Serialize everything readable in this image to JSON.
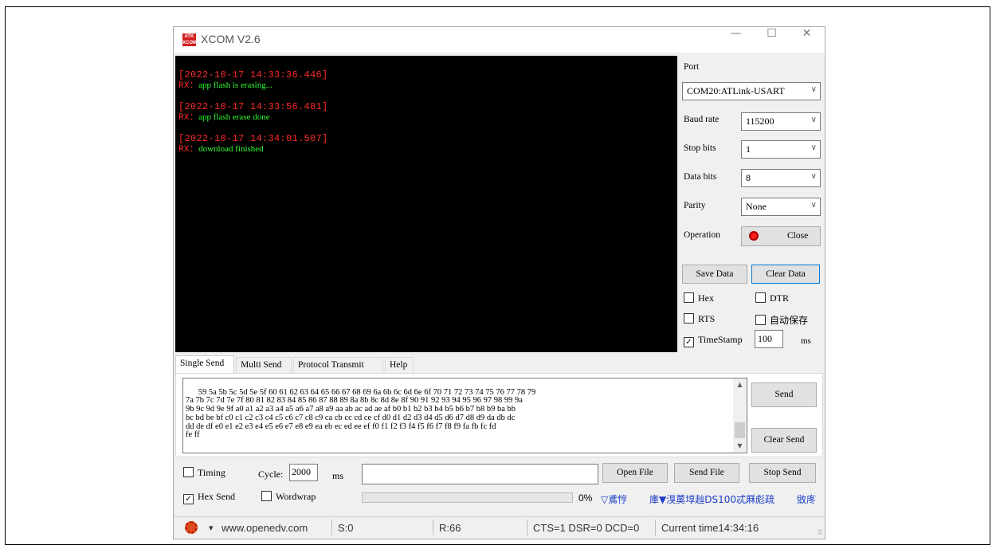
{
  "window": {
    "title": "XCOM V2.6",
    "logo_text": "ATK XCOM",
    "minimize_glyph": "—",
    "maximize_glyph": "☐",
    "close_glyph": "✕"
  },
  "terminal": {
    "entries": [
      {
        "time": "[2022-10-17 14:33:36.446]",
        "rx_prefix": "RX：",
        "rx_text": "app flash is erasing..."
      },
      {
        "time": "[2022-10-17 14:33:56.481]",
        "rx_prefix": "RX：",
        "rx_text": "app flash erase done"
      },
      {
        "time": "[2022-10-17 14:34:01.507]",
        "rx_prefix": "RX：",
        "rx_text": "download finished"
      }
    ]
  },
  "settings": {
    "port_label": "Port",
    "port_value": "COM20:ATLink-USART",
    "baud_label": "Baud rate",
    "baud_value": "115200",
    "stopbits_label": "Stop bits",
    "stopbits_value": "1",
    "databits_label": "Data bits",
    "databits_value": "8",
    "parity_label": "Parity",
    "parity_value": "None",
    "operation_label": "Operation",
    "operation_button": "Close",
    "save_data": "Save Data",
    "clear_data": "Clear Data",
    "hex_label": "Hex",
    "dtr_label": "DTR",
    "rts_label": "RTS",
    "autosave_label": "自动保存",
    "timestamp_label": "TimeStamp",
    "timestamp_value": "100",
    "timestamp_unit": "ms",
    "hex_checked": false,
    "dtr_checked": false,
    "rts_checked": false,
    "autosave_checked": false,
    "timestamp_checked": true
  },
  "tabs": [
    "Single Send",
    "Multi Send",
    "Protocol Transmit",
    "Help"
  ],
  "send": {
    "text": "59 5a 5b 5c 5d 5e 5f 60 61 62 63 64 65 66 67 68 69 6a 6b 6c 6d 6e 6f 70 71 72 73 74 75 76 77 78 79\n7a 7b 7c 7d 7e 7f 80 81 82 83 84 85 86 87 88 89 8a 8b 8c 8d 8e 8f 90 91 92 93 94 95 96 97 98 99 9a\n9b 9c 9d 9e 9f a0 a1 a2 a3 a4 a5 a6 a7 a8 a9 aa ab ac ad ae af b0 b1 b2 b3 b4 b5 b6 b7 b8 b9 ba bb\nbc bd be bf c0 c1 c2 c3 c4 c5 c6 c7 c8 c9 ca cb cc cd ce cf d0 d1 d2 d3 d4 d5 d6 d7 d8 d9 da db dc\ndd de df e0 e1 e2 e3 e4 e5 e6 e7 e8 e9 ea eb ec ed ee ef f0 f1 f2 f3 f4 f5 f6 f7 f8 f9 fa fb fc fd\nfe ff",
    "send_button": "Send",
    "clear_send_button": "Clear Send",
    "timing_label": "Timing",
    "timing_checked": false,
    "cycle_label": "Cycle:",
    "cycle_value": "2000",
    "cycle_unit": "ms",
    "file_path": "",
    "open_file": "Open File",
    "send_file": "Send File",
    "stop_send": "Stop Send",
    "hex_send_label": "Hex Send",
    "hex_send_checked": true,
    "wordwrap_label": "Wordwrap",
    "wordwrap_checked": false,
    "progress_percent_text": "0%",
    "progress": 0,
    "link_1": "▽鳶悙",
    "link_2": "庫▼湨薁埻赸DS100忒厤彪疏",
    "link_3": "敓庝"
  },
  "status": {
    "website": "www.openedv.com",
    "s_count": "S:0",
    "r_count": "R:66",
    "lines": "CTS=1 DSR=0 DCD=0",
    "current_time": "Current time14:34:16",
    "dropdown_glyph": "▾",
    "grip_glyph": "⠿"
  },
  "colors": {
    "time_text": "#ff2a2a",
    "rx_text": "#33ff33",
    "terminal_bg": "#000000",
    "link_blue": "#1a3cc8",
    "led_red": "#ff1f1f"
  }
}
